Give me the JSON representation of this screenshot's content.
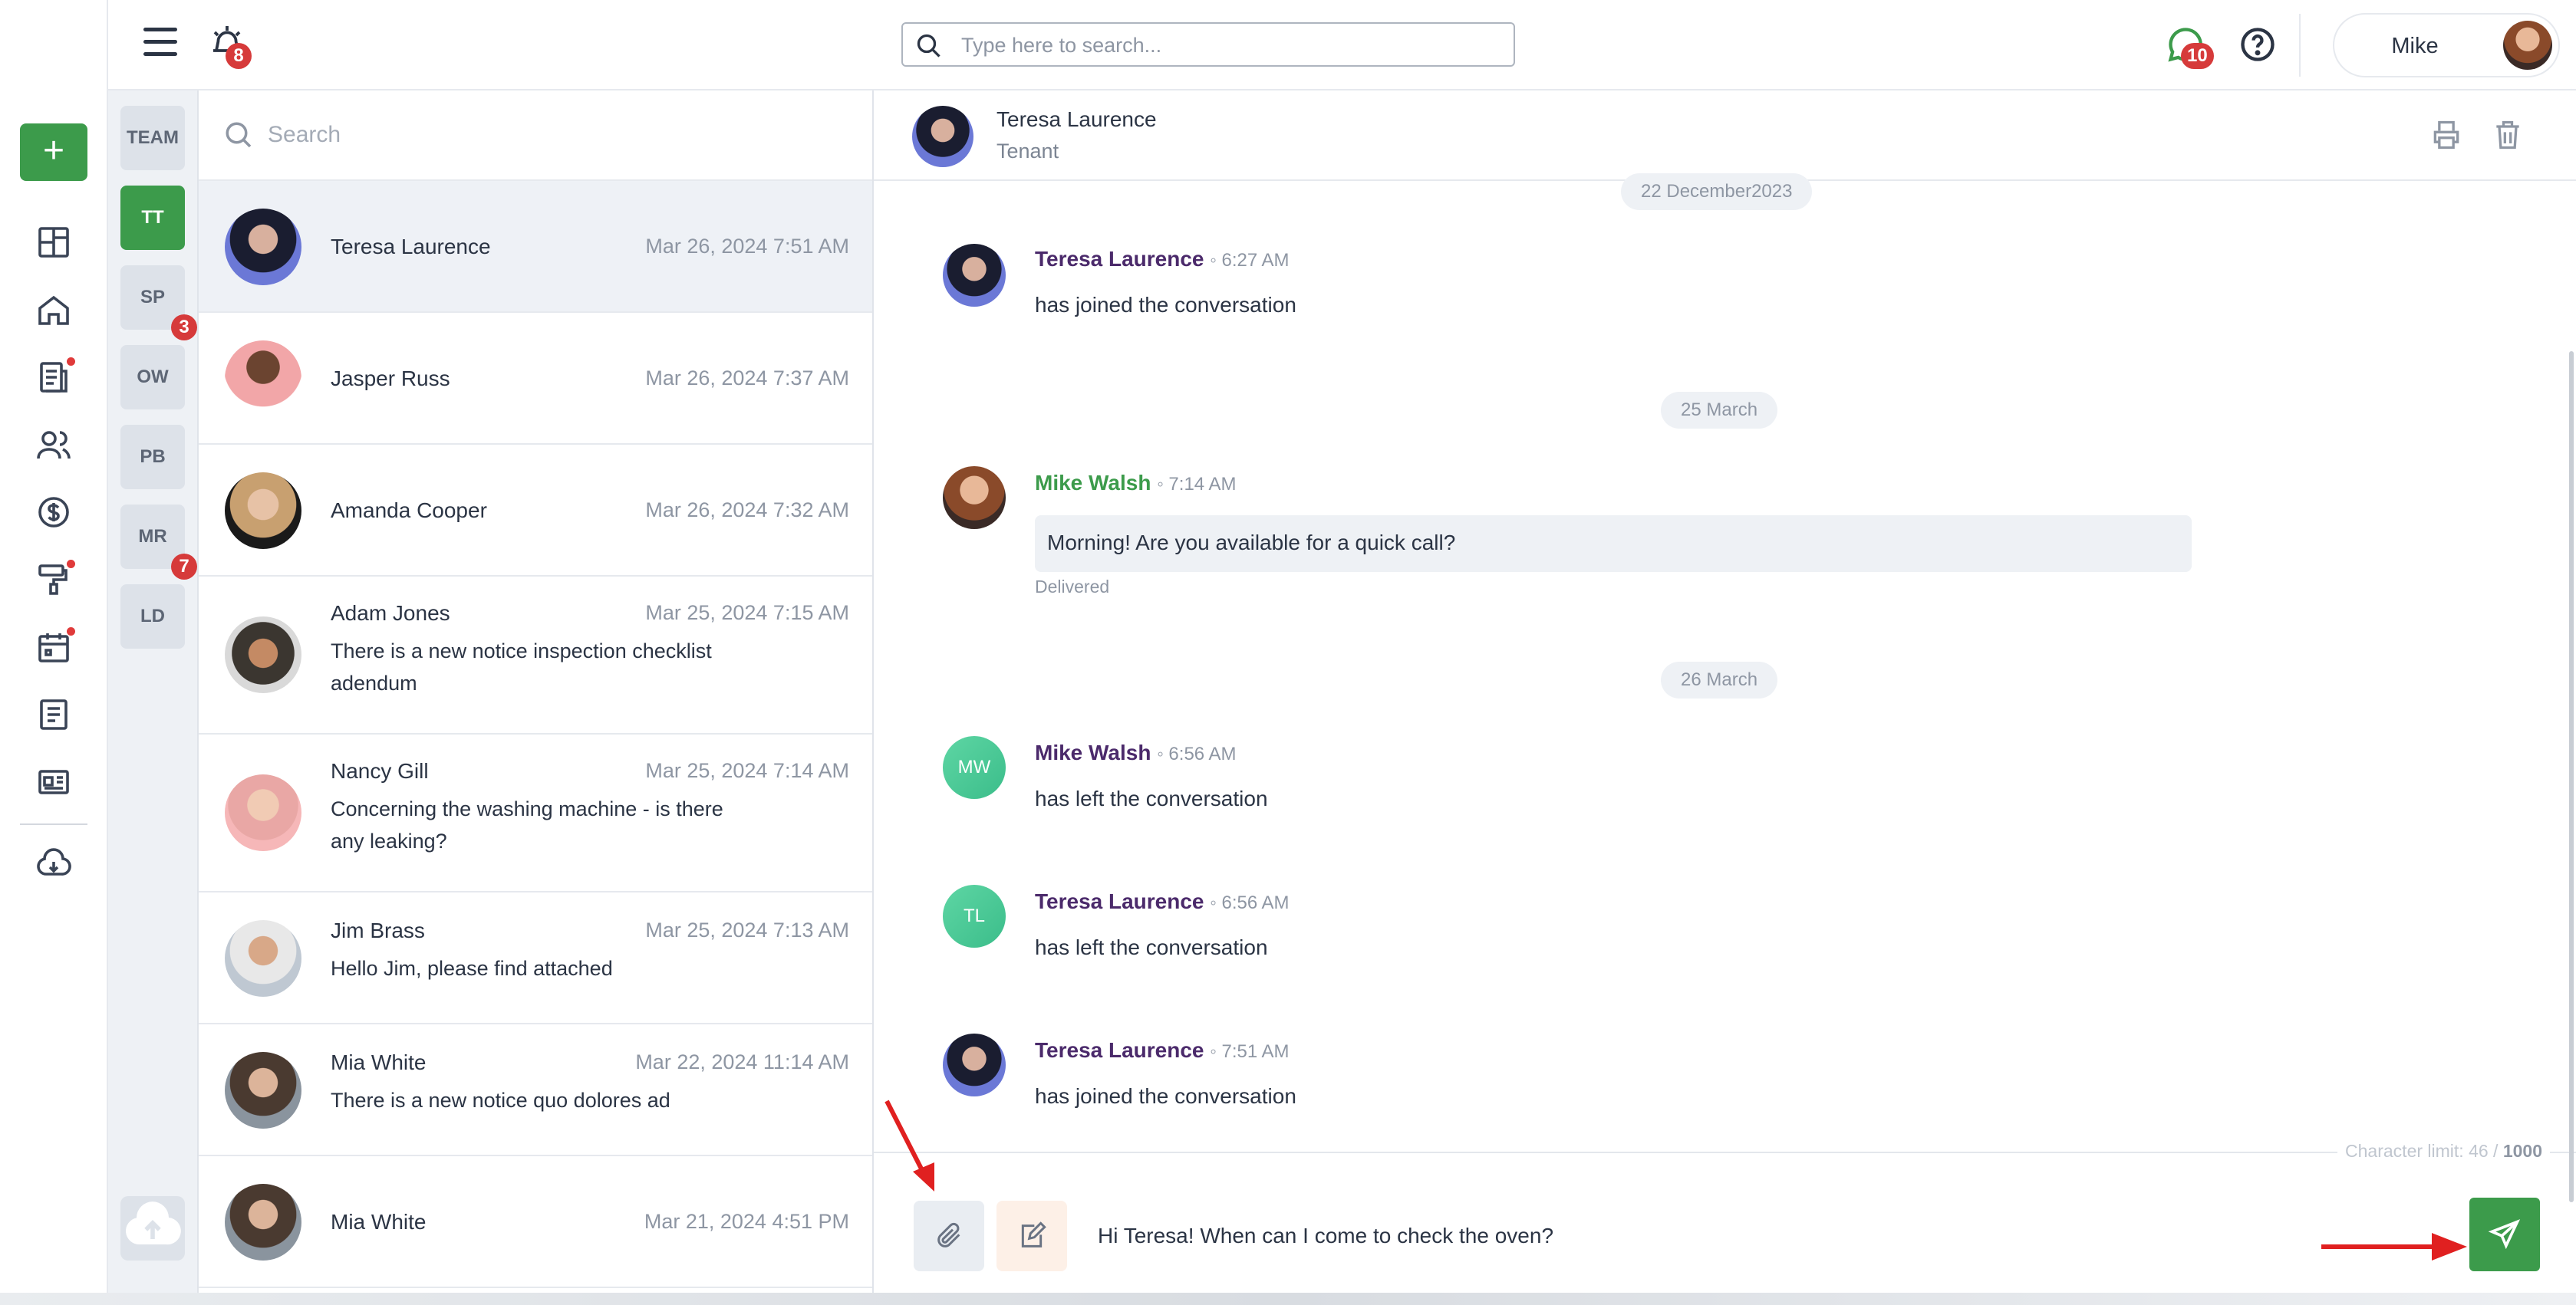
{
  "header": {
    "notification_count": "8",
    "search_placeholder": "Type here to search...",
    "chat_count": "10",
    "user_name": "Mike"
  },
  "groups": [
    {
      "label": "TEAM",
      "badge": ""
    },
    {
      "label": "TT",
      "badge": "",
      "active": true
    },
    {
      "label": "SP",
      "badge": "3"
    },
    {
      "label": "OW",
      "badge": ""
    },
    {
      "label": "PB",
      "badge": ""
    },
    {
      "label": "MR",
      "badge": "7"
    },
    {
      "label": "LD",
      "badge": ""
    }
  ],
  "list": {
    "search_placeholder": "Search",
    "conversations": [
      {
        "name": "Teresa Laurence",
        "date": "Mar 26, 2024 7:51 AM",
        "preview": ""
      },
      {
        "name": "Jasper Russ",
        "date": "Mar 26, 2024 7:37 AM",
        "preview": ""
      },
      {
        "name": "Amanda Cooper",
        "date": "Mar 26, 2024 7:32 AM",
        "preview": ""
      },
      {
        "name": "Adam Jones",
        "date": "Mar 25, 2024 7:15 AM",
        "preview": "There is a new notice inspection checklist adendum"
      },
      {
        "name": "Nancy Gill",
        "date": "Mar 25, 2024 7:14 AM",
        "preview": "Concerning the washing machine - is there any leaking?"
      },
      {
        "name": "Jim Brass",
        "date": "Mar 25, 2024 7:13 AM",
        "preview": "Hello Jim, please find attached"
      },
      {
        "name": "Mia White",
        "date": "Mar 22, 2024 11:14 AM",
        "preview": "There is a new notice quo dolores ad"
      },
      {
        "name": "Mia White",
        "date": "Mar 21, 2024 4:51 PM",
        "preview": ""
      }
    ]
  },
  "chat": {
    "contact_name": "Teresa Laurence",
    "contact_role": "Tenant",
    "dates": [
      "22 December2023",
      "25 March",
      "26 March"
    ],
    "messages": [
      {
        "author": "Teresa Laurence",
        "time": "6:27 AM",
        "text": "has joined the conversation"
      },
      {
        "author": "Mike Walsh",
        "time": "7:14 AM",
        "text": "Morning! Are you available for a quick call?",
        "status": "Delivered"
      },
      {
        "author": "Mike Walsh",
        "time": "6:56 AM",
        "text": "has left the conversation",
        "initials": "MW"
      },
      {
        "author": "Teresa Laurence",
        "time": "6:56 AM",
        "text": "has left the conversation",
        "initials": "TL"
      },
      {
        "author": "Teresa Laurence",
        "time": "7:51 AM",
        "text": "has joined the conversation"
      }
    ],
    "char_limit_label": "Character limit: 46 /",
    "char_limit_max": "1000",
    "composer_value": "Hi Teresa! When can I come to check the oven?"
  }
}
